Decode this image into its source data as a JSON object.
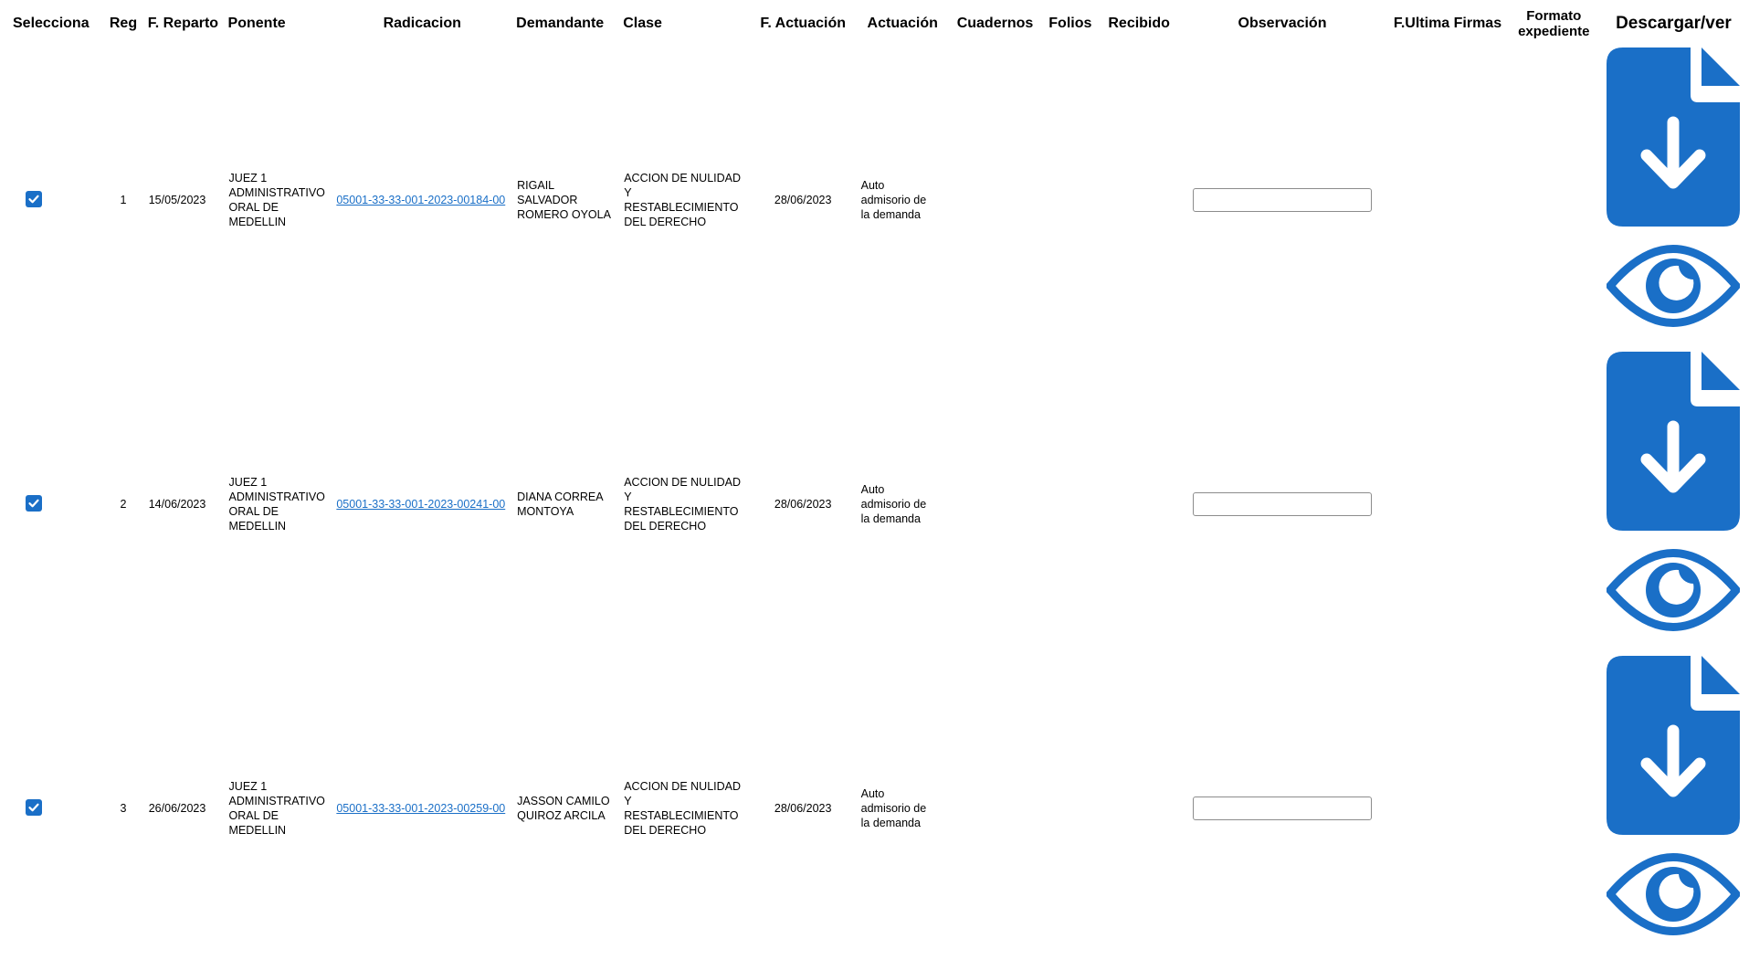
{
  "headers": {
    "selecciona": "Selecciona",
    "reg": "Reg",
    "f_reparto": "F. Reparto",
    "ponente": "Ponente",
    "radicacion": "Radicacion",
    "demandante": "Demandante",
    "clase": "Clase",
    "f_actuacion": "F. Actuación",
    "actuacion": "Actuación",
    "cuadernos": "Cuadernos",
    "folios": "Folios",
    "recibido": "Recibido",
    "observacion": "Observación",
    "f_ultima": "F.Ultima Firmas",
    "formato": "Formato expediente",
    "descargar": "Descargar/ver"
  },
  "rows": [
    {
      "checked": true,
      "reg": "1",
      "f_reparto": "15/05/2023",
      "ponente": "JUEZ 1 ADMINISTRATIVO ORAL DE MEDELLIN",
      "radicacion": "05001-33-33-001-2023-00184-00",
      "demandante": "RIGAIL SALVADOR ROMERO OYOLA",
      "clase": "ACCION DE NULIDAD Y RESTABLECIMIENTO DEL DERECHO",
      "f_actuacion": "28/06/2023",
      "actuacion": "Auto admisorio de la demanda",
      "observacion": ""
    },
    {
      "checked": true,
      "reg": "2",
      "f_reparto": "14/06/2023",
      "ponente": "JUEZ 1 ADMINISTRATIVO ORAL DE MEDELLIN",
      "radicacion": "05001-33-33-001-2023-00241-00",
      "demandante": "DIANA CORREA MONTOYA",
      "clase": "ACCION DE NULIDAD Y RESTABLECIMIENTO DEL DERECHO",
      "f_actuacion": "28/06/2023",
      "actuacion": "Auto admisorio de la demanda",
      "observacion": ""
    },
    {
      "checked": true,
      "reg": "3",
      "f_reparto": "26/06/2023",
      "ponente": "JUEZ 1 ADMINISTRATIVO ORAL DE MEDELLIN",
      "radicacion": "05001-33-33-001-2023-00259-00",
      "demandante": "JASSON CAMILO QUIROZ ARCILA",
      "clase": "ACCION DE NULIDAD Y RESTABLECIMIENTO DEL DERECHO",
      "f_actuacion": "28/06/2023",
      "actuacion": "Auto admisorio de la demanda",
      "observacion": ""
    }
  ],
  "icons": {
    "download": "file-download-icon",
    "view": "eye-icon"
  },
  "colors": {
    "accent": "#1a6fc7"
  }
}
